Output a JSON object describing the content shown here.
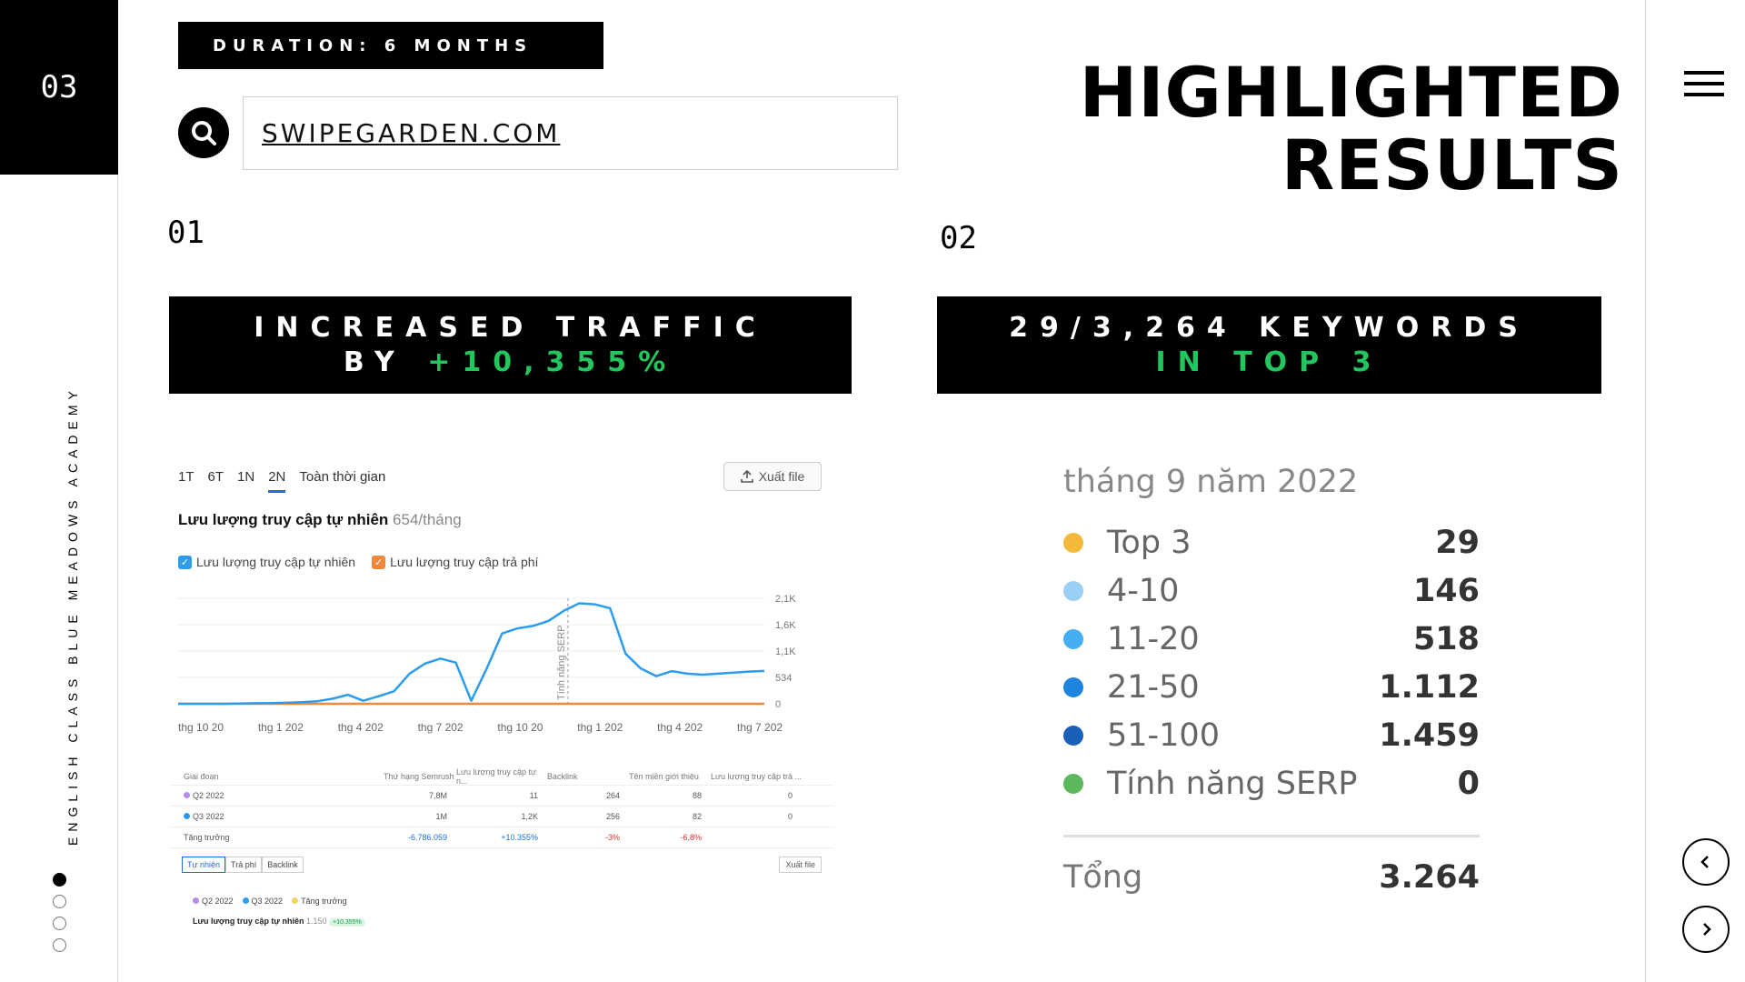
{
  "slide": {
    "number": "03"
  },
  "sidebar": {
    "vertical_text": "ENGLISH CLASS BLUE MEADOWS ACADEMY",
    "dots": [
      {
        "active": true
      },
      {
        "active": false
      },
      {
        "active": false
      },
      {
        "active": false
      }
    ]
  },
  "header": {
    "duration": "DURATION: 6 MONTHS",
    "search_value": "SWIPEGARDEN.COM",
    "title_line1": "HIGHLIGHTED",
    "title_line2": "RESULTS"
  },
  "sections": [
    {
      "number": "01",
      "line1": "INCREASED TRAFFIC",
      "line2_prefix": "BY ",
      "line2_highlight": "+10,355%"
    },
    {
      "number": "02",
      "line1": "29/3,264 KEYWORDS",
      "line2_prefix": "",
      "line2_highlight": "IN TOP 3"
    }
  ],
  "traffic_panel": {
    "range_tabs": [
      "1T",
      "6T",
      "1N",
      "2N",
      "Toàn thời gian"
    ],
    "active_tab": "2N",
    "export_label": "Xuất file",
    "title": "Lưu lượng truy cập tự nhiên",
    "title_value": "654",
    "title_unit": "/tháng",
    "legend": [
      {
        "label": "Lưu lượng truy cập tự nhiên",
        "color": "#2c9cf0"
      },
      {
        "label": "Lưu lượng truy cập trả phí",
        "color": "#f0883a"
      }
    ],
    "chart_data": {
      "type": "line",
      "x": [
        "thg 10 20",
        "thg 1 202",
        "thg 4 202",
        "thg 7 202",
        "thg 10 20",
        "thg 1 202",
        "thg 4 202",
        "thg 7 202"
      ],
      "y_ticks": [
        "2,1K",
        "1,6K",
        "1,1K",
        "534",
        "0"
      ],
      "ylim": [
        0,
        2100
      ],
      "annotation": "Tính năng SERP",
      "series": [
        {
          "name": "Lưu lượng truy cập tự nhiên",
          "color": "#2c9cf0",
          "values": [
            0,
            0,
            0,
            0,
            5,
            10,
            15,
            20,
            30,
            50,
            100,
            180,
            60,
            150,
            250,
            600,
            800,
            900,
            820,
            60,
            700,
            1400,
            1500,
            1550,
            1650,
            1850,
            2000,
            1980,
            1900,
            1000,
            700,
            550,
            650,
            600,
            580,
            600,
            620,
            640,
            654
          ]
        },
        {
          "name": "Lưu lượng truy cập trả phí",
          "color": "#f0883a",
          "values": [
            0,
            0,
            0,
            0,
            0,
            0,
            0,
            0,
            0,
            0,
            0,
            0,
            0,
            0,
            0,
            0,
            0,
            0,
            0,
            0,
            0,
            0,
            0,
            0,
            0,
            0,
            0,
            0,
            0,
            0,
            0,
            0,
            0,
            0,
            0,
            0,
            0,
            0,
            0
          ]
        }
      ]
    },
    "table": {
      "headers": [
        "Giai đoạn",
        "Thứ hạng Semrush",
        "Lưu lượng truy cập tự n...",
        "Backlink",
        "Tên miền giới thiệu",
        "Lưu lượng truy cập trả ..."
      ],
      "rows": [
        {
          "period": "Q2 2022",
          "dot": "#b58cf0",
          "rank": "7,8M",
          "traffic": "11",
          "backlink": "264",
          "domains": "88",
          "paid": "0"
        },
        {
          "period": "Q3 2022",
          "dot": "#2c9cf0",
          "rank": "1M",
          "traffic": "1,2K",
          "backlink": "256",
          "domains": "82",
          "paid": "0"
        },
        {
          "period": "Tăng trưởng",
          "dot": "",
          "rank": "-6.786.059",
          "traffic": "+10.355%",
          "backlink": "-3%",
          "domains": "-6,8%",
          "paid": ""
        }
      ]
    },
    "subtabs": [
      "Tự nhiên",
      "Trả phí",
      "Backlink"
    ],
    "export_small": "Xuất file",
    "legend2": [
      "Q2 2022",
      "Q3 2022",
      "Tăng trưởng"
    ],
    "footer_label": "Lưu lượng truy cập tự nhiên",
    "footer_value": "1.150",
    "footer_badge": "+10.355%"
  },
  "keywords_panel": {
    "title": "tháng 9 năm 2022",
    "rows": [
      {
        "label": "Top 3",
        "value": "29",
        "color": "#f4b93a"
      },
      {
        "label": "4-10",
        "value": "146",
        "color": "#9ccff5"
      },
      {
        "label": "11-20",
        "value": "518",
        "color": "#45aef2"
      },
      {
        "label": "21-50",
        "value": "1.112",
        "color": "#1d84e0"
      },
      {
        "label": "51-100",
        "value": "1.459",
        "color": "#1a5fb8"
      },
      {
        "label": "Tính năng SERP",
        "value": "0",
        "color": "#5cb85c"
      }
    ],
    "total_label": "Tổng",
    "total_value": "3.264"
  }
}
